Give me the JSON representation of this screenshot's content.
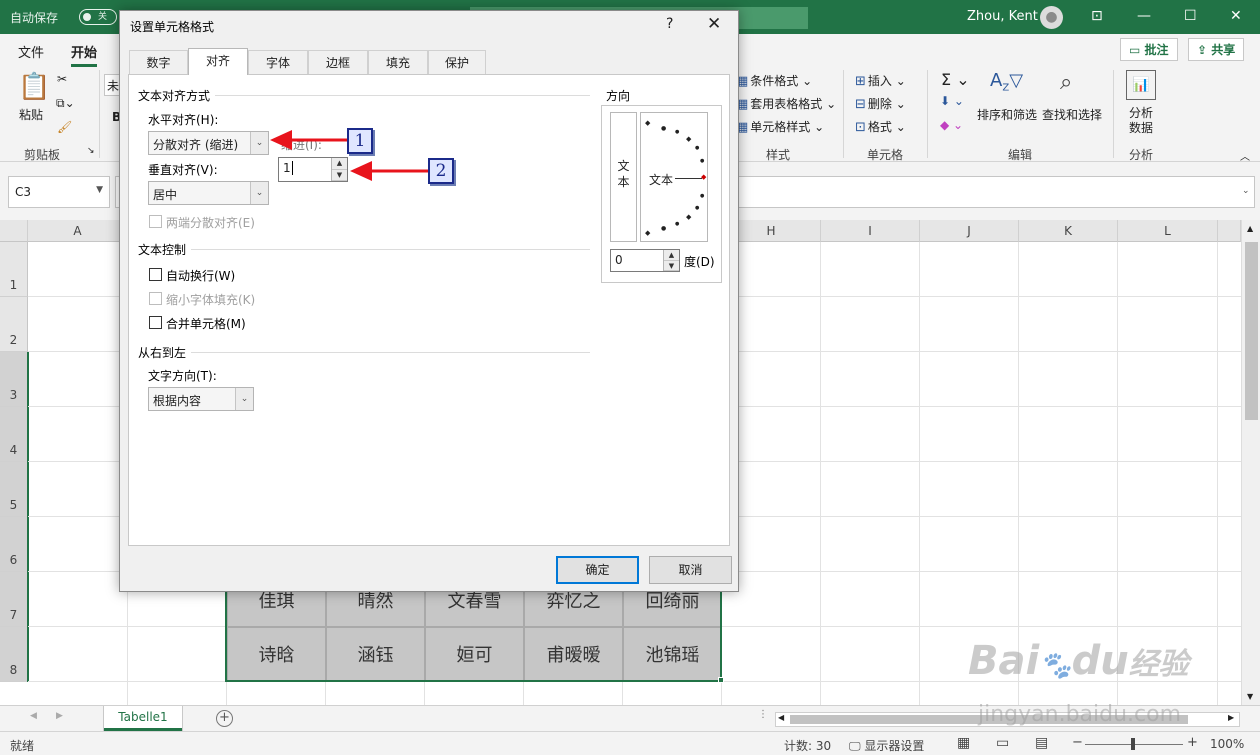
{
  "titlebar": {
    "autosave_label": "自动保存",
    "autosave_state": "关",
    "user_name": "Zhou, Kent"
  },
  "ribbon": {
    "tabs": [
      {
        "label": "文件",
        "active": false
      },
      {
        "label": "开始",
        "active": true
      }
    ],
    "share_buttons": {
      "comment": "批注",
      "share": "共享"
    },
    "clipboard": {
      "paste": "粘贴",
      "group": "剪贴板"
    },
    "font_name_partial": "未",
    "styles": {
      "conditional": "条件格式",
      "table_format": "套用表格格式",
      "cell_styles": "单元格样式",
      "group": "样式"
    },
    "cells": {
      "insert": "插入",
      "delete": "删除",
      "format": "格式",
      "group": "单元格"
    },
    "editing": {
      "sort_filter": "排序和筛选",
      "find_select": "查找和选择",
      "group": "编辑"
    },
    "analysis": {
      "analyze_line1": "分析",
      "analyze_line2": "数据",
      "group": "分析"
    }
  },
  "formula_bar": {
    "name_box": "C3"
  },
  "grid": {
    "columns": [
      "A",
      "H",
      "I",
      "J",
      "K",
      "L"
    ],
    "rows": [
      "1",
      "2",
      "3",
      "4",
      "5",
      "6",
      "7",
      "8"
    ],
    "names_row7": [
      "佳琪",
      "晴然",
      "文春雪",
      "弈忆之",
      "回绮丽"
    ],
    "names_row8": [
      "诗晗",
      "涵钰",
      "姮可",
      "甫暧暧",
      "池锦瑶"
    ]
  },
  "sheet_tabs": {
    "active": "Tabelle1"
  },
  "statusbar": {
    "ready": "就绪",
    "count": "计数: 30",
    "display_settings": "显示器设置",
    "zoom": "100%"
  },
  "dialog": {
    "title": "设置单元格格式",
    "help": "?",
    "tabs": [
      {
        "label": "数字",
        "active": false
      },
      {
        "label": "对齐",
        "active": true
      },
      {
        "label": "字体",
        "active": false
      },
      {
        "label": "边框",
        "active": false
      },
      {
        "label": "填充",
        "active": false
      },
      {
        "label": "保护",
        "active": false
      }
    ],
    "text_alignment": {
      "section": "文本对齐方式",
      "horizontal_label": "水平对齐(H):",
      "horizontal_value": "分散对齐 (缩进)",
      "indent_label": "缩进(I):",
      "indent_value": "1",
      "vertical_label": "垂直对齐(V):",
      "vertical_value": "居中",
      "justify_distributed": "两端分散对齐(E)"
    },
    "text_control": {
      "section": "文本控制",
      "wrap_text": "自动换行(W)",
      "shrink_to_fit": "缩小字体填充(K)",
      "merge_cells": "合并单元格(M)"
    },
    "rtl": {
      "section": "从右到左",
      "direction_label": "文字方向(T):",
      "direction_value": "根据内容"
    },
    "orientation": {
      "section": "方向",
      "vertical_text_1": "文",
      "vertical_text_2": "本",
      "dial_text": "文本",
      "degrees_value": "0",
      "degrees_label": "度(D)"
    },
    "ok": "确定",
    "cancel": "取消"
  },
  "annotations": {
    "badge1": "1",
    "badge2": "2",
    "arrow_color": "#e8141c"
  },
  "watermark": {
    "brand": "Bai",
    "brand2": "du",
    "suffix": "经验",
    "url": "jingyan.baidu.com"
  }
}
